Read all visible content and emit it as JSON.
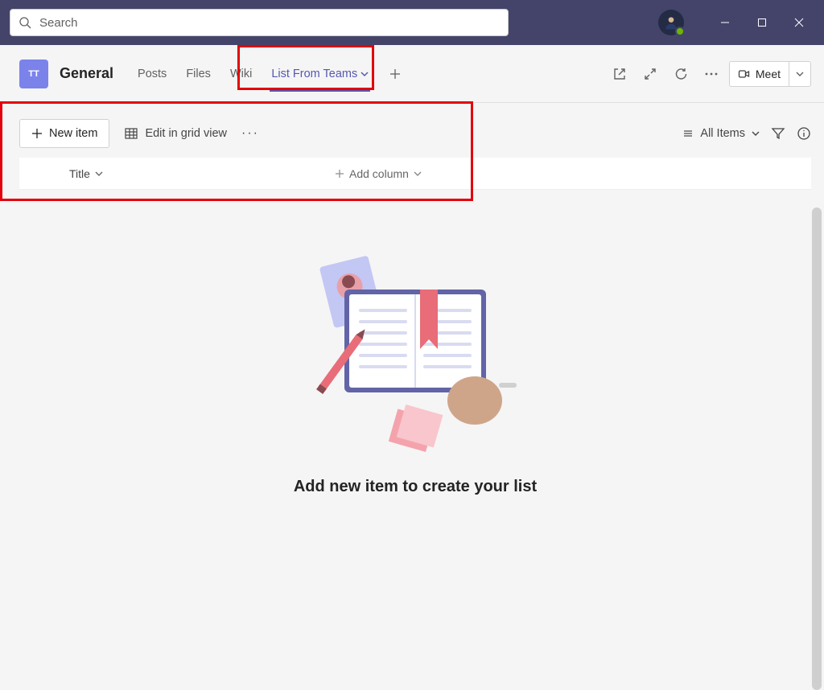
{
  "search": {
    "placeholder": "Search"
  },
  "team": {
    "initials": "TT",
    "channel": "General"
  },
  "tabs": {
    "posts": "Posts",
    "files": "Files",
    "wiki": "Wiki",
    "listFromTeams": "List From Teams"
  },
  "header": {
    "meet": "Meet"
  },
  "toolbar": {
    "newItem": "New item",
    "editGrid": "Edit in grid view",
    "allItems": "All Items"
  },
  "columns": {
    "title": "Title",
    "addColumn": "Add column"
  },
  "emptyState": {
    "message": "Add new item to create your list"
  }
}
